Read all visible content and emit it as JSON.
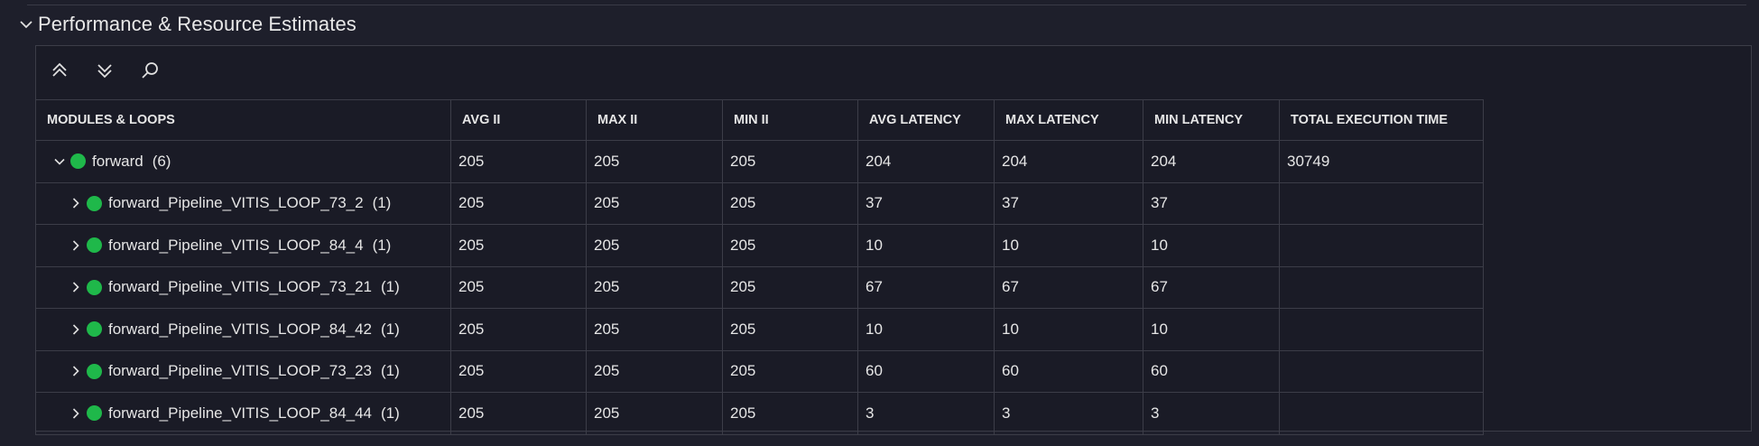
{
  "section": {
    "title": "Performance & Resource Estimates",
    "expanded": true
  },
  "toolbar": {
    "icons": [
      "collapse-all-icon",
      "expand-all-icon",
      "search-icon"
    ]
  },
  "colors": {
    "status_ok": "#1fb84a",
    "background": "#1e1f2b",
    "panel": "#1a1b26",
    "border": "#3c3d48"
  },
  "table": {
    "headers": {
      "modules": "MODULES & LOOPS",
      "avg_ii": "AVG II",
      "max_ii": "MAX II",
      "min_ii": "MIN II",
      "avg_latency": "AVG LATENCY",
      "max_latency": "MAX LATENCY",
      "min_latency": "MIN LATENCY",
      "total_exec": "TOTAL EXECUTION TIME"
    },
    "rows": [
      {
        "name": "forward",
        "count": "(6)",
        "expanded": true,
        "avg_ii": "205",
        "max_ii": "205",
        "min_ii": "205",
        "avg_latency": "204",
        "max_latency": "204",
        "min_latency": "204",
        "total_exec": "30749"
      },
      {
        "name": "forward_Pipeline_VITIS_LOOP_73_2",
        "count": "(1)",
        "expanded": false,
        "avg_ii": "205",
        "max_ii": "205",
        "min_ii": "205",
        "avg_latency": "37",
        "max_latency": "37",
        "min_latency": "37",
        "total_exec": ""
      },
      {
        "name": "forward_Pipeline_VITIS_LOOP_84_4",
        "count": "(1)",
        "expanded": false,
        "avg_ii": "205",
        "max_ii": "205",
        "min_ii": "205",
        "avg_latency": "10",
        "max_latency": "10",
        "min_latency": "10",
        "total_exec": ""
      },
      {
        "name": "forward_Pipeline_VITIS_LOOP_73_21",
        "count": "(1)",
        "expanded": false,
        "avg_ii": "205",
        "max_ii": "205",
        "min_ii": "205",
        "avg_latency": "67",
        "max_latency": "67",
        "min_latency": "67",
        "total_exec": ""
      },
      {
        "name": "forward_Pipeline_VITIS_LOOP_84_42",
        "count": "(1)",
        "expanded": false,
        "avg_ii": "205",
        "max_ii": "205",
        "min_ii": "205",
        "avg_latency": "10",
        "max_latency": "10",
        "min_latency": "10",
        "total_exec": ""
      },
      {
        "name": "forward_Pipeline_VITIS_LOOP_73_23",
        "count": "(1)",
        "expanded": false,
        "avg_ii": "205",
        "max_ii": "205",
        "min_ii": "205",
        "avg_latency": "60",
        "max_latency": "60",
        "min_latency": "60",
        "total_exec": ""
      },
      {
        "name": "forward_Pipeline_VITIS_LOOP_84_44",
        "count": "(1)",
        "expanded": false,
        "avg_ii": "205",
        "max_ii": "205",
        "min_ii": "205",
        "avg_latency": "3",
        "max_latency": "3",
        "min_latency": "3",
        "total_exec": ""
      }
    ]
  }
}
